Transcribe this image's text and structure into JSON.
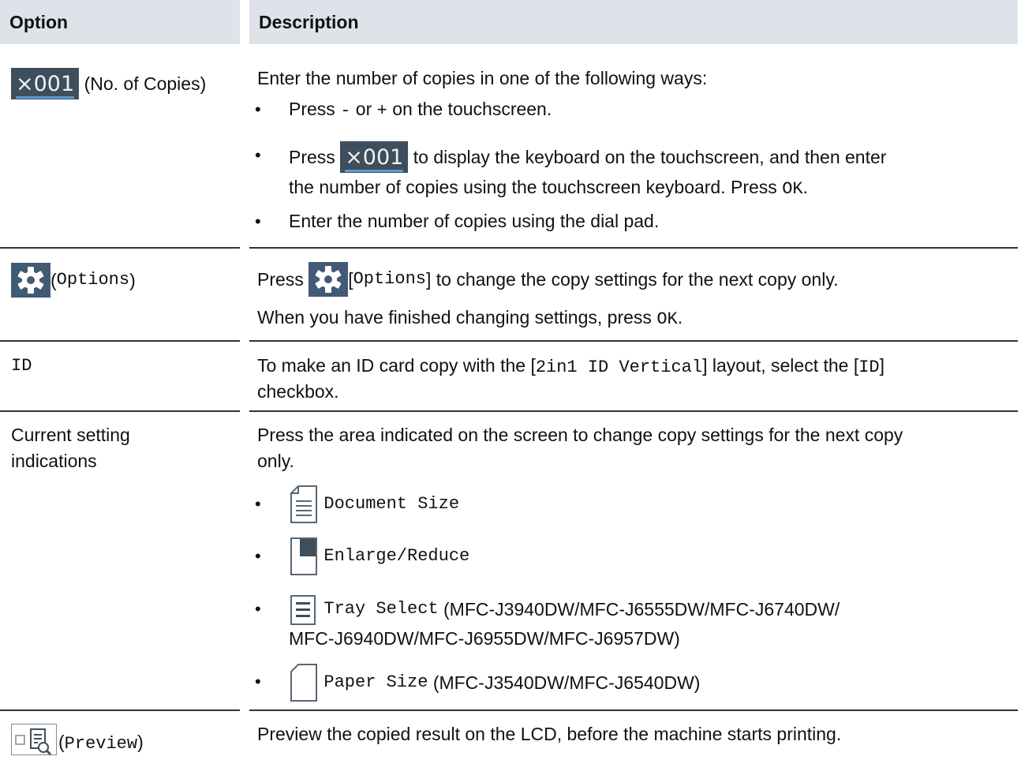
{
  "header": {
    "option": "Option",
    "description": "Description"
  },
  "rows": {
    "copies": {
      "button_value": "×001",
      "option_label": "(No. of Copies)",
      "intro": "Enter the number of copies in one of the following ways:",
      "b1_press": "Press",
      "b1_minus": "-",
      "b1_or": "or",
      "b1_plus": "+",
      "b1_end": "on the touchscreen.",
      "b2_press": "Press",
      "b2_after": "to display the keyboard on the touchscreen, and then enter",
      "b2_line2": "the number of copies using the touchscreen keyboard. Press",
      "b2_ok": "OK",
      "b2_dot": ".",
      "b3": "Enter the number of copies using the dial pad."
    },
    "options": {
      "paren_open": "(",
      "label": "Options",
      "paren_close": ")",
      "press": "Press",
      "bracket_open": "[",
      "bracket_label": "Options",
      "bracket_close": "]",
      "after": "to change the copy settings for the next copy only.",
      "line2": "When you have finished changing settings, press",
      "ok": "OK",
      "dot": "."
    },
    "id": {
      "label": "ID",
      "text1": "To make an ID card copy with the [",
      "layout": "2in1 ID Vertical",
      "text2": "] layout, select the [",
      "id": "ID",
      "text3": "]",
      "line2": "checkbox."
    },
    "current": {
      "label_line1": "Current setting",
      "label_line2": "indications",
      "desc_line1": "Press the area indicated on the screen to change copy settings for the next copy",
      "desc_line2": "only.",
      "items": {
        "doc_size": "Document Size",
        "enlarge": "Enlarge/Reduce",
        "tray": "Tray Select",
        "tray_models1": "(MFC-J3940DW/MFC-J6555DW/MFC-J6740DW/",
        "tray_models2": "MFC-J6940DW/MFC-J6955DW/MFC-J6957DW)",
        "paper": "Paper Size",
        "paper_models": "(MFC-J3540DW/MFC-J6540DW)"
      }
    },
    "preview": {
      "paren_open": "(",
      "label": "Preview",
      "paren_close": ")",
      "desc": "Preview the copied result on the LCD, before the machine starts printing."
    }
  },
  "bullet": "•",
  "colors": {
    "header_bg": "#dde3e9",
    "copy_button_bg": "#3f4e5c",
    "gear_bg": "#435a74",
    "underline": "#5b9bd5"
  }
}
